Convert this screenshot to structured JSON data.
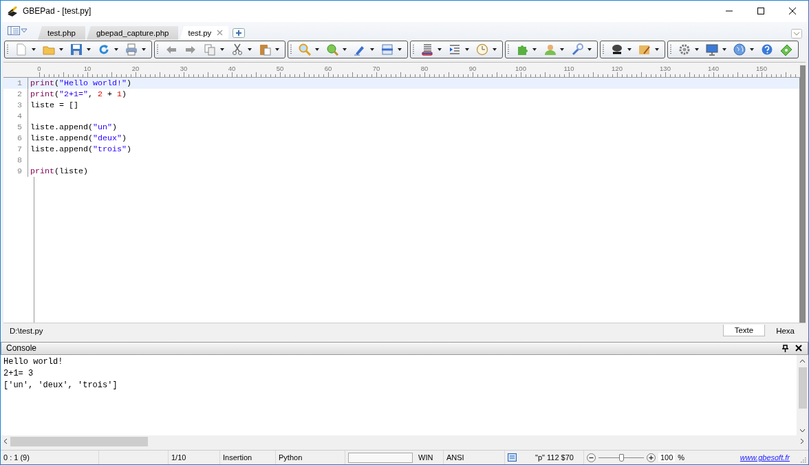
{
  "window": {
    "title": "GBEPad - [test.py]"
  },
  "tabs": [
    {
      "label": "test.php",
      "selected": false
    },
    {
      "label": "gbepad_capture.php",
      "selected": false
    },
    {
      "label": "test.py",
      "selected": true
    }
  ],
  "ruler": {
    "labels": [
      "0",
      "10",
      "20",
      "30",
      "40",
      "50",
      "60",
      "70",
      "80",
      "90",
      "100",
      "110",
      "120",
      "130",
      "140",
      "150"
    ]
  },
  "editor": {
    "lines": [
      {
        "number": "1",
        "selected": true,
        "tokens": [
          {
            "kind": "keyword",
            "text": "print"
          },
          {
            "kind": "plain",
            "text": "("
          },
          {
            "kind": "string",
            "text": "\"Hello world!\""
          },
          {
            "kind": "plain",
            "text": ")"
          }
        ]
      },
      {
        "number": "2",
        "selected": false,
        "tokens": [
          {
            "kind": "keyword",
            "text": "print"
          },
          {
            "kind": "plain",
            "text": "("
          },
          {
            "kind": "string",
            "text": "\"2+1=\""
          },
          {
            "kind": "plain",
            "text": ", "
          },
          {
            "kind": "number",
            "text": "2"
          },
          {
            "kind": "plain",
            "text": " + "
          },
          {
            "kind": "number",
            "text": "1"
          },
          {
            "kind": "plain",
            "text": ")"
          }
        ]
      },
      {
        "number": "3",
        "selected": false,
        "tokens": [
          {
            "kind": "plain",
            "text": "liste = []"
          }
        ]
      },
      {
        "number": "4",
        "selected": false
      },
      {
        "number": "5",
        "selected": false,
        "tokens": [
          {
            "kind": "plain",
            "text": "liste.append("
          },
          {
            "kind": "string",
            "text": "\"un\""
          },
          {
            "kind": "plain",
            "text": ")"
          }
        ]
      },
      {
        "number": "6",
        "selected": false,
        "tokens": [
          {
            "kind": "plain",
            "text": "liste.append("
          },
          {
            "kind": "string",
            "text": "\"deux\""
          },
          {
            "kind": "plain",
            "text": ")"
          }
        ]
      },
      {
        "number": "7",
        "selected": false,
        "tokens": [
          {
            "kind": "plain",
            "text": "liste.append("
          },
          {
            "kind": "string",
            "text": "\"trois\""
          },
          {
            "kind": "plain",
            "text": ")"
          }
        ]
      },
      {
        "number": "8",
        "selected": false
      },
      {
        "number": "9",
        "selected": false,
        "tokens": [
          {
            "kind": "keyword",
            "text": "print"
          },
          {
            "kind": "plain",
            "text": "(liste)"
          }
        ]
      }
    ]
  },
  "file_path": "D:\\test.py",
  "view_tabs": [
    {
      "label": "Texte",
      "selected": true
    },
    {
      "label": "Hexa",
      "selected": false
    }
  ],
  "console": {
    "title": "Console",
    "lines": [
      "Hello world!",
      "2+1= 3",
      "['un', 'deux', 'trois']"
    ]
  },
  "status_bar": {
    "position": "0 : 1 (9)",
    "line_count": "1/10",
    "mode": "Insertion",
    "language": "Python",
    "line_ending": "WIN",
    "encoding": "ANSI",
    "character": "\"p\" 112 $70",
    "zoom": {
      "level": 0.5,
      "value": "100",
      "unit": "%"
    },
    "link": "www.gbesoft.fr"
  }
}
